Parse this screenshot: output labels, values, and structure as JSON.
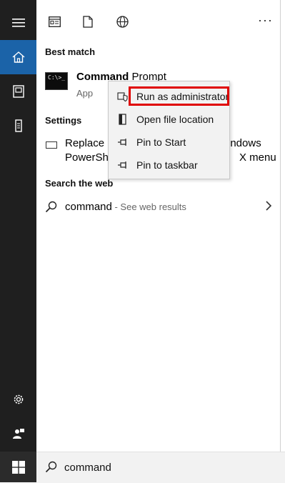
{
  "top_icons": [
    "document-list-icon",
    "file-icon",
    "globe-icon"
  ],
  "more_label": "···",
  "sections": {
    "best_match": "Best match",
    "settings": "Settings",
    "search_web": "Search the web"
  },
  "best_match": {
    "title_bold": "Command",
    "title_rest": " Prompt",
    "subtitle": "App",
    "icon_text": "C:\\>_"
  },
  "setting_result": {
    "line1_left": "Replace C",
    "line1_right": "indows",
    "line2_left": "PowerShe",
    "line2_right": "X menu"
  },
  "web_result": {
    "query": "command",
    "hint": " - See web results"
  },
  "context_menu": {
    "items": [
      {
        "label": "Run as administrator",
        "icon": "shield-icon"
      },
      {
        "label": "Open file location",
        "icon": "file-location-icon"
      },
      {
        "label": "Pin to Start",
        "icon": "pin-icon"
      },
      {
        "label": "Pin to taskbar",
        "icon": "pin-icon"
      }
    ]
  },
  "search": {
    "value": "command"
  },
  "colors": {
    "rail": "#1f1f1f",
    "active": "#1b63a8",
    "highlight": "#e00000"
  }
}
